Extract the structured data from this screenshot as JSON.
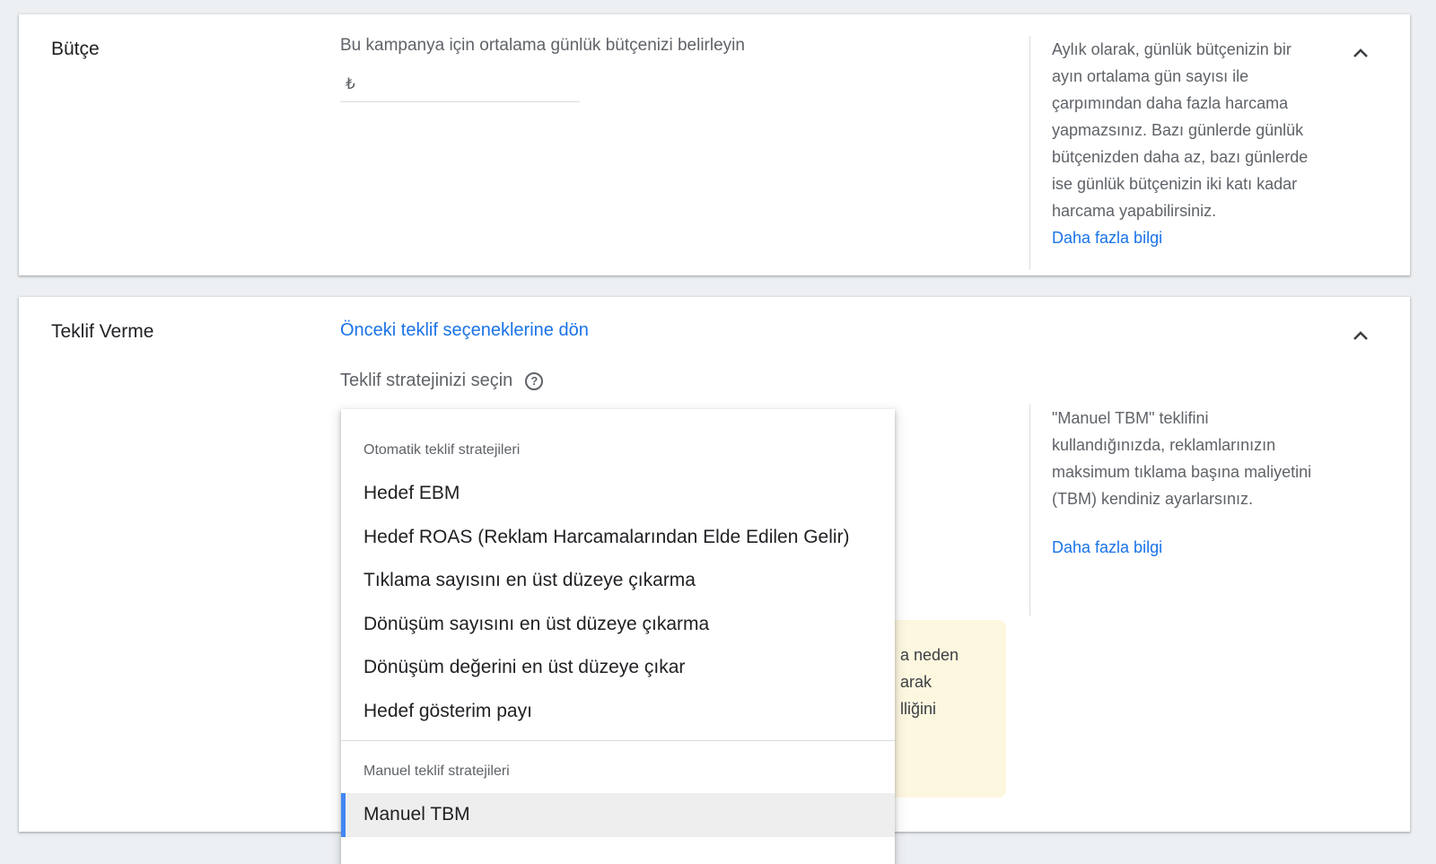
{
  "budget": {
    "title": "Bütçe",
    "prompt": "Bu kampanya için ortalama günlük bütçenizi belirleyin",
    "currency_symbol": "₺",
    "input_value": "",
    "help_text": "Aylık olarak, günlük bütçenizin bir ayın ortalama gün sayısı ile çarpımından daha fazla harcama yapmazsınız. Bazı günlerde günlük bütçenizden daha az, bazı günlerde ise günlük bütçenizin iki katı kadar harcama yapabilirsiniz.",
    "help_link": "Daha fazla bilgi"
  },
  "bidding": {
    "title": "Teklif Verme",
    "back_link": "Önceki teklif seçeneklerine dön",
    "strategy_label": "Teklif stratejinizi seçin",
    "help_text": "\"Manuel TBM\" teklifini kullandığınızda, reklamlarınızın maksimum tıklama başına maliyetini (TBM) kendiniz ayarlarsınız.",
    "help_link": "Daha fazla bilgi",
    "notice_lines": [
      "a neden",
      "arak",
      "lliğini"
    ]
  },
  "dropdown": {
    "auto_label": "Otomatik teklif stratejileri",
    "auto_items": [
      "Hedef EBM",
      "Hedef ROAS (Reklam Harcamalarından Elde Edilen Gelir)",
      "Tıklama sayısını en üst düzeye çıkarma",
      "Dönüşüm sayısını en üst düzeye çıkarma",
      "Dönüşüm değerini en üst düzeye çıkar",
      "Hedef gösterim payı"
    ],
    "manual_label": "Manuel teklif stratejileri",
    "manual_items": [
      "Manuel TBM"
    ]
  },
  "colors": {
    "accent": "#1a73e8",
    "selected_indicator": "#4285f4",
    "notice_bg": "#fef7e0",
    "page_bg": "#edf0f3"
  }
}
